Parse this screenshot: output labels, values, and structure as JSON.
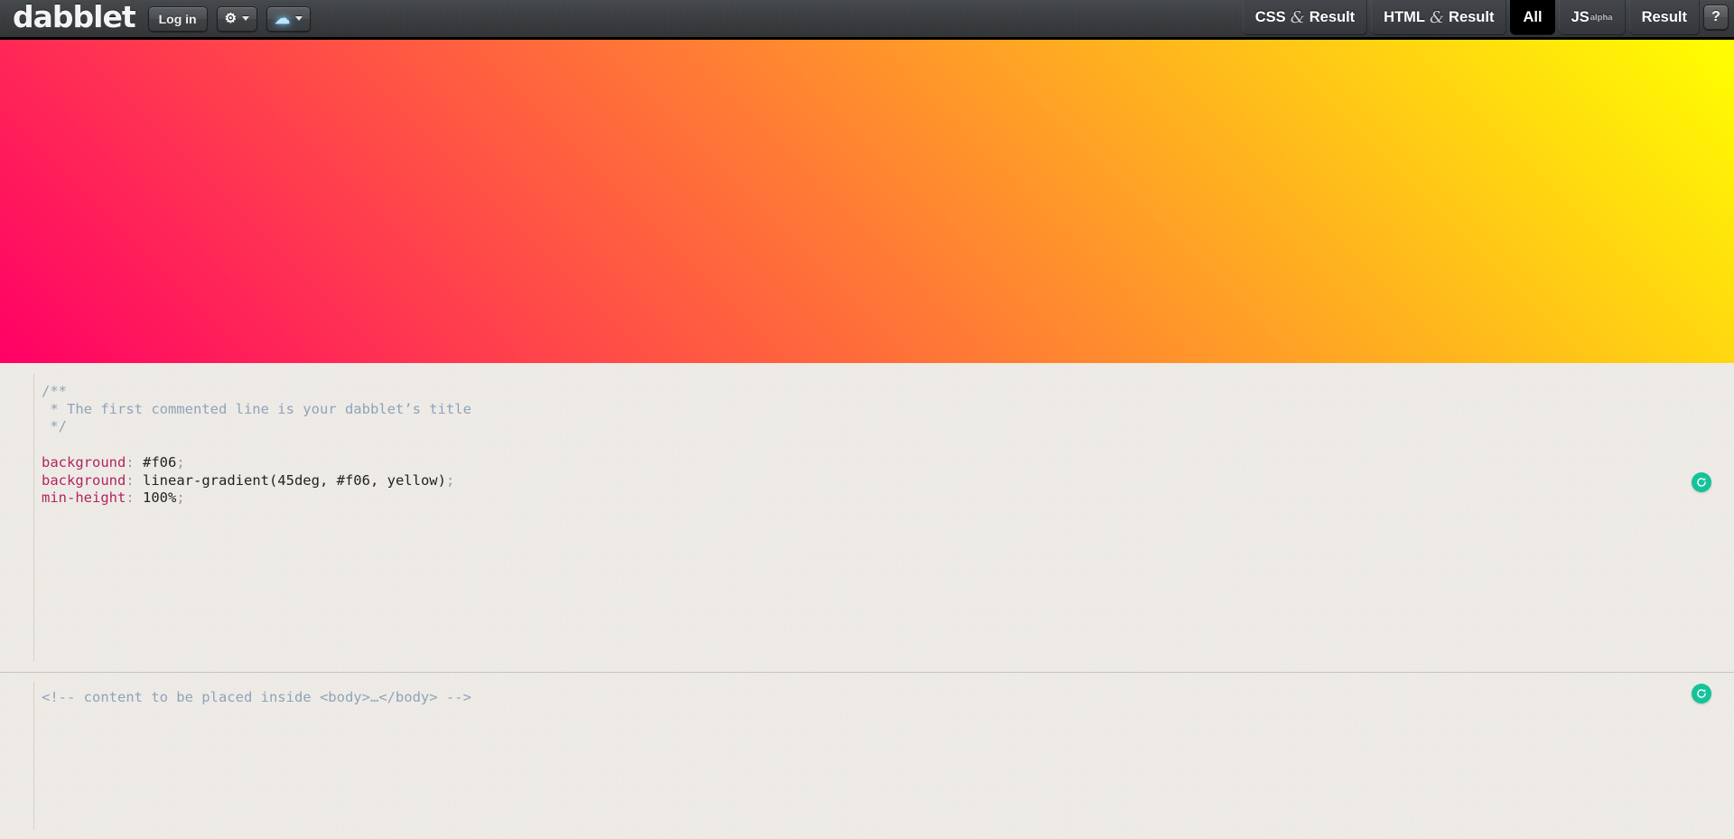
{
  "app": {
    "name": "dabblet",
    "logo_text": "dabblet"
  },
  "toolbar": {
    "login_label": "Log in",
    "settings_icon": "gear-icon",
    "settings_caret": "chevron-down-icon",
    "save_icon": "cloud-upload-icon",
    "save_caret": "chevron-down-icon"
  },
  "tabs": [
    {
      "id": "css-result",
      "label": "CSS",
      "separator": "&",
      "suffix": "Result",
      "active": false
    },
    {
      "id": "html-result",
      "label": "HTML",
      "separator": "&",
      "suffix": "Result",
      "active": false
    },
    {
      "id": "all",
      "label": "All",
      "separator": "",
      "suffix": "",
      "active": true
    },
    {
      "id": "js",
      "label": "JS",
      "separator": "",
      "suffix": "",
      "sub": "alpha",
      "active": false
    },
    {
      "id": "result",
      "label": "Result",
      "separator": "",
      "suffix": "",
      "active": false
    }
  ],
  "help": {
    "label": "?",
    "icon": "question-mark-icon"
  },
  "preview": {
    "gradient_angle": "45deg",
    "color_start": "#ff0066",
    "color_end": "#ffff00",
    "fallback_color": "#ff0066",
    "min_height": "100%"
  },
  "css_editor": {
    "reload_icon": "reload-icon",
    "lines": [
      {
        "type": "comment",
        "text": "/**"
      },
      {
        "type": "comment",
        "text": " * The first commented line is your dabblet’s title"
      },
      {
        "type": "comment",
        "text": " */"
      },
      {
        "type": "blank",
        "text": ""
      },
      {
        "type": "decl",
        "prop": "background",
        "colon": ": ",
        "value": "#f06",
        "semi": ";"
      },
      {
        "type": "decl",
        "prop": "background",
        "colon": ": ",
        "value": "linear-gradient(45deg, #f06, yellow)",
        "semi": ";"
      },
      {
        "type": "decl",
        "prop": "min-height",
        "colon": ": ",
        "value": "100%",
        "semi": ";"
      }
    ]
  },
  "html_editor": {
    "reload_icon": "reload-icon",
    "lines": [
      {
        "type": "comment",
        "text": "<!-- content to be placed inside <body>…</body> -->"
      }
    ]
  },
  "colors": {
    "topbar_bg": "#3a3d40",
    "editor_bg": "#f1eee9",
    "accent_green": "#14c39a",
    "comment_blue": "#8fa3b8",
    "property_pink": "#b0255f"
  }
}
